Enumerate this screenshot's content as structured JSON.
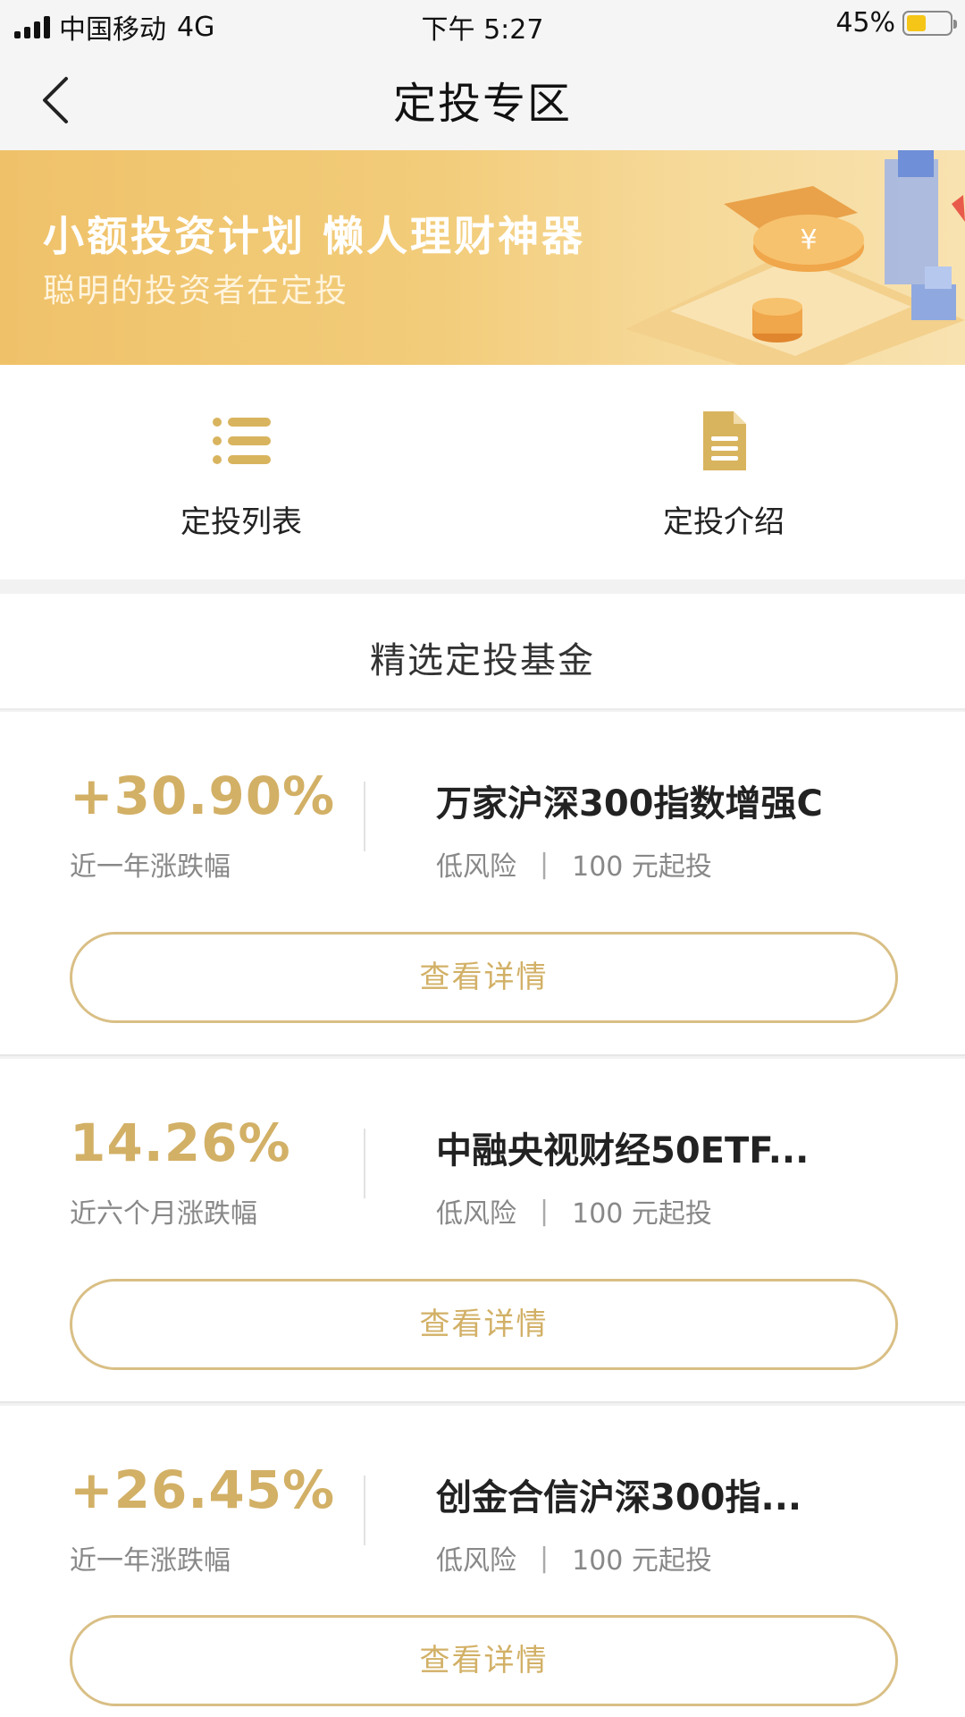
{
  "status_bar": {
    "carrier": "中国移动",
    "network": "4G",
    "time": "下午 5:27",
    "battery_percent": "45%",
    "battery_level": 0.45,
    "battery_color": "#f5c518"
  },
  "nav": {
    "title": "定投专区",
    "back_icon": "chevron-left-icon"
  },
  "banner": {
    "title": "小额投资计划  懒人理财神器",
    "subtitle": "聪明的投资者在定投"
  },
  "quick_menu": [
    {
      "label": "定投列表",
      "icon": "list-icon"
    },
    {
      "label": "定投介绍",
      "icon": "document-icon"
    }
  ],
  "section": {
    "title": "精选定投基金"
  },
  "funds": [
    {
      "rate": "+30.90%",
      "period": "近一年涨跌幅",
      "name": "万家沪深300指数增强C",
      "risk": "低风险",
      "min_invest": "100 元起投",
      "button": "查看详情"
    },
    {
      "rate": "14.26%",
      "period": "近六个月涨跌幅",
      "name": "中融央视财经50ETF...",
      "risk": "低风险",
      "min_invest": "100 元起投",
      "button": "查看详情"
    },
    {
      "rate": "+26.45%",
      "period": "近一年涨跌幅",
      "name": "创金合信沪深300指...",
      "risk": "低风险",
      "min_invest": "100 元起投",
      "button": "查看详情"
    }
  ],
  "colors": {
    "accent_gold": "#d2b066",
    "button_border": "#d9bf85",
    "banner_gold": "#efc26a"
  }
}
